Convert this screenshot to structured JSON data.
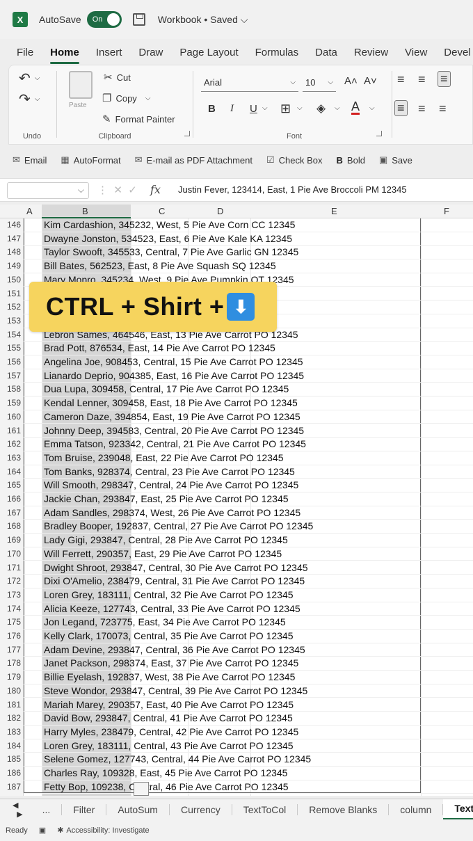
{
  "titlebar": {
    "logo_letter": "X",
    "autosave_label": "AutoSave",
    "autosave_state": "On",
    "workbook_title": "Workbook • Saved ⌵"
  },
  "tabs": [
    "File",
    "Home",
    "Insert",
    "Draw",
    "Page Layout",
    "Formulas",
    "Data",
    "Review",
    "View",
    "Devel"
  ],
  "ribbon": {
    "undo_label": "Undo",
    "clipboard": {
      "cut": "Cut",
      "copy": "Copy",
      "format_painter": "Format Painter",
      "paste": "Paste",
      "label": "Clipboard"
    },
    "font": {
      "name": "Arial",
      "size": "10",
      "label": "Font",
      "bold": "B",
      "italic": "I",
      "underline": "U",
      "grow": "A˄",
      "shrink": "A˅"
    }
  },
  "qab": [
    "Email",
    "AutoFormat",
    "E-mail as PDF Attachment",
    "Check Box",
    "Bold",
    "Save"
  ],
  "formula_bar": {
    "fx": "fx",
    "value": "Justin Fever, 123414, East, 1 Pie Ave Broccoli PM 12345"
  },
  "columns": [
    "A",
    "B",
    "C",
    "D",
    "E",
    "F"
  ],
  "rows": [
    {
      "n": "146",
      "t": "Kim Cardashion, 345232, West, 5 Pie Ave Corn CC 12345"
    },
    {
      "n": "147",
      "t": "Dwayne Jonston, 534523, East, 6 Pie Ave Kale KA 12345"
    },
    {
      "n": "148",
      "t": "Taylor Swooft, 345533, Central, 7 Pie Ave Garlic GN 12345"
    },
    {
      "n": "149",
      "t": "Bill Bates, 562523, East, 8 Pie Ave Squash SQ 12345"
    },
    {
      "n": "150",
      "t": "Mary Monro, 345234, West, 9 Pie Ave Pumpkin OT 12345"
    },
    {
      "n": "151",
      "t": "                                                    ry CL 12345"
    },
    {
      "n": "152",
      "t": "                                                    t PO 12345"
    },
    {
      "n": "153",
      "t": "                                                    PO 12345"
    },
    {
      "n": "154",
      "t": "Lebron Sames, 464546, East, 13 Pie Ave Carrot PO 12345"
    },
    {
      "n": "155",
      "t": "Brad Pott, 876534, East, 14 Pie Ave Carrot PO 12345"
    },
    {
      "n": "156",
      "t": "Angelina Joe, 908453, Central, 15 Pie Ave Carrot PO 12345"
    },
    {
      "n": "157",
      "t": "Lianardo Deprio, 904385, East, 16 Pie Ave Carrot PO 12345"
    },
    {
      "n": "158",
      "t": "Dua Lupa, 309458, Central, 17 Pie Ave Carrot PO 12345"
    },
    {
      "n": "159",
      "t": "Kendal Lenner, 309458, East, 18 Pie Ave Carrot PO 12345"
    },
    {
      "n": "160",
      "t": "Cameron Daze, 394854, East, 19 Pie Ave Carrot PO 12345"
    },
    {
      "n": "161",
      "t": "Johnny Deep, 394583, Central, 20 Pie Ave Carrot PO 12345"
    },
    {
      "n": "162",
      "t": "Emma Tatson, 923342, Central, 21 Pie Ave Carrot PO 12345"
    },
    {
      "n": "163",
      "t": "Tom Bruise, 239048, East, 22 Pie Ave Carrot PO 12345"
    },
    {
      "n": "164",
      "t": "Tom Banks, 928374, Central, 23 Pie Ave Carrot PO 12345"
    },
    {
      "n": "165",
      "t": "Will Smooth, 298347, Central, 24 Pie Ave Carrot PO 12345"
    },
    {
      "n": "166",
      "t": "Jackie Chan, 293847, East, 25 Pie Ave Carrot PO 12345"
    },
    {
      "n": "167",
      "t": "Adam Sandles, 298374, West, 26 Pie Ave Carrot PO 12345"
    },
    {
      "n": "168",
      "t": "Bradley Booper, 192837, Central, 27 Pie Ave Carrot PO 12345"
    },
    {
      "n": "169",
      "t": "Lady Gigi, 293847, Central, 28 Pie Ave Carrot PO 12345"
    },
    {
      "n": "170",
      "t": "Will Ferrett, 290357, East, 29 Pie Ave Carrot PO 12345"
    },
    {
      "n": "171",
      "t": "Dwight Shroot, 293847, Central, 30 Pie Ave Carrot PO 12345"
    },
    {
      "n": "172",
      "t": "Dixi O'Amelio, 238479, Central, 31 Pie Ave Carrot PO 12345"
    },
    {
      "n": "173",
      "t": "Loren Grey, 183111, Central, 32 Pie Ave Carrot PO 12345"
    },
    {
      "n": "174",
      "t": "Alicia Keeze, 127743, Central, 33 Pie Ave Carrot PO 12345"
    },
    {
      "n": "175",
      "t": "Jon Legand, 723775, East, 34 Pie Ave Carrot PO 12345"
    },
    {
      "n": "176",
      "t": "Kelly Clark, 170073, Central, 35 Pie Ave Carrot PO 12345"
    },
    {
      "n": "177",
      "t": "Adam Devine, 293847, Central, 36 Pie Ave Carrot PO 12345"
    },
    {
      "n": "178",
      "t": "Janet Packson, 298374, East, 37 Pie Ave Carrot PO 12345"
    },
    {
      "n": "179",
      "t": "Billie Eyelash, 192837, West, 38 Pie Ave Carrot PO 12345"
    },
    {
      "n": "180",
      "t": "Steve Wondor, 293847, Central, 39 Pie Ave Carrot PO 12345"
    },
    {
      "n": "181",
      "t": "Mariah Marey, 290357, East, 40 Pie Ave Carrot PO 12345"
    },
    {
      "n": "182",
      "t": "David Bow, 293847, Central, 41 Pie Ave Carrot PO 12345"
    },
    {
      "n": "183",
      "t": "Harry Myles, 238479, Central, 42 Pie Ave Carrot PO 12345"
    },
    {
      "n": "184",
      "t": "Loren Grey, 183111, Central, 43 Pie Ave Carrot PO 12345"
    },
    {
      "n": "185",
      "t": "Selene Gomez, 127743, Central, 44 Pie Ave Carrot PO 12345"
    },
    {
      "n": "186",
      "t": "Charles Ray, 109328, East, 45 Pie Ave Carrot PO 12345"
    },
    {
      "n": "187",
      "t": "Fetty Bop, 109238, Central, 46 Pie Ave Carrot PO 12345"
    }
  ],
  "overlay": {
    "text": "CTRL + Shirt +",
    "arrow": "⬇"
  },
  "sheet_tabs": [
    "...",
    "Filter",
    "AutoSum",
    "Currency",
    "TextToCol",
    "Remove Blanks",
    "column",
    "Text T"
  ],
  "status": {
    "ready": "Ready",
    "accessibility": "Accessibility: Investigate"
  },
  "colors": {
    "accent": "#1e6b43",
    "overlay_bg": "#f6d45e",
    "arrow_bg": "#2f8ee0"
  }
}
